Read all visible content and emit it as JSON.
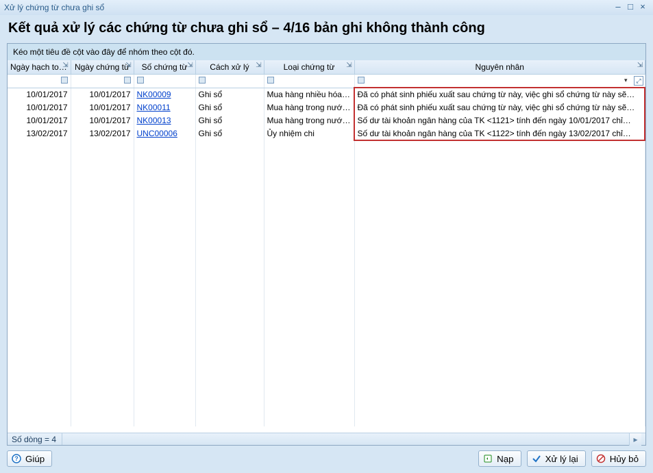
{
  "window": {
    "title": "Xử lý chứng từ chưa ghi sổ"
  },
  "heading": "Kết quả xử lý các chứng từ chưa ghi sổ – 4/16 bản ghi không thành công",
  "group_panel": "Kéo một tiêu đề cột vào đây để nhóm theo cột đó.",
  "columns": {
    "ngayhachtoan": "Ngày hạch toán",
    "ngaychungtu": "Ngày chứng từ",
    "sochungtu": "Số chứng từ",
    "cachxuly": "Cách xử lý",
    "loaichungtu": "Loại chứng từ",
    "nguyennhan": "Nguyên nhân"
  },
  "rows": [
    {
      "ngayhachtoan": "10/01/2017",
      "ngaychungtu": "10/01/2017",
      "sochungtu": "NK00009",
      "cachxuly": "Ghi sổ",
      "loaichungtu": "Mua hàng nhiều hóa đơ…",
      "nguyennhan": "Đã có phát sinh phiếu xuất sau chứng từ này, việc ghi sổ chứng từ này sẽ…"
    },
    {
      "ngayhachtoan": "10/01/2017",
      "ngaychungtu": "10/01/2017",
      "sochungtu": "NK00011",
      "cachxuly": "Ghi sổ",
      "loaichungtu": "Mua hàng trong nước n…",
      "nguyennhan": "Đã có phát sinh phiếu xuất sau chứng từ này, việc ghi sổ chứng từ này sẽ…"
    },
    {
      "ngayhachtoan": "10/01/2017",
      "ngaychungtu": "10/01/2017",
      "sochungtu": "NK00013",
      "cachxuly": "Ghi sổ",
      "loaichungtu": "Mua hàng trong nước n…",
      "nguyennhan": "Số dư tài khoản ngân hàng của TK <1121> tính đến ngày 10/01/2017 chỉ…"
    },
    {
      "ngayhachtoan": "13/02/2017",
      "ngaychungtu": "13/02/2017",
      "sochungtu": "UNC00006",
      "cachxuly": "Ghi sổ",
      "loaichungtu": "Ủy nhiệm chi",
      "nguyennhan": "Số dư tài khoản ngân hàng của TK <1122> tính đến ngày 13/02/2017 chỉ…"
    }
  ],
  "status": {
    "row_count_label": "Số dòng = 4"
  },
  "buttons": {
    "help": "Giúp",
    "nap": "Nạp",
    "xulylai": "Xử lý lại",
    "huybo": "Hủy bỏ"
  }
}
